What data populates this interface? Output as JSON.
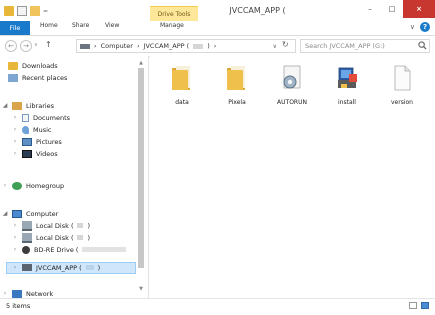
{
  "window": {
    "title": "JVCCAM_APP (",
    "context_tab": "Drive Tools",
    "controls": {
      "minimize": "–",
      "maximize": "□",
      "close": "×"
    }
  },
  "ribbon": {
    "tabs": [
      "File",
      "Home",
      "Share",
      "View",
      "Manage"
    ],
    "expand": "∨",
    "help": "?"
  },
  "nav": {
    "back": "←",
    "forward": "→",
    "up": "↑",
    "breadcrumb": [
      "Computer",
      "JVCCAM_APP ("
    ],
    "breadcrumb_sep": "›",
    "dropdown": "∨",
    "refresh": "↻",
    "search_placeholder": "Search JVCCAM_APP (G:)"
  },
  "navpane": {
    "favorites": [
      "Downloads",
      "Recent places"
    ],
    "libraries": {
      "label": "Libraries",
      "items": [
        "Documents",
        "Music",
        "Pictures",
        "Videos"
      ]
    },
    "homegroup": "Homegroup",
    "computer": {
      "label": "Computer",
      "items": [
        "Local Disk (",
        "Local Disk (",
        "BD-RE Drive (",
        "JVCCAM_APP ("
      ]
    },
    "network": "Network"
  },
  "files": [
    {
      "name": "data",
      "icon": "folder-icon"
    },
    {
      "name": "Pixela",
      "icon": "folder-icon"
    },
    {
      "name": "AUTORUN",
      "icon": "settings-file-icon"
    },
    {
      "name": "install",
      "icon": "installer-icon"
    },
    {
      "name": "version",
      "icon": "blank-file-icon"
    }
  ],
  "status": {
    "count": "5 items"
  },
  "colors": {
    "accent": "#1979ca",
    "folder": "#e8b73a",
    "selection": "#cfe6fb",
    "close": "#c7372f"
  }
}
